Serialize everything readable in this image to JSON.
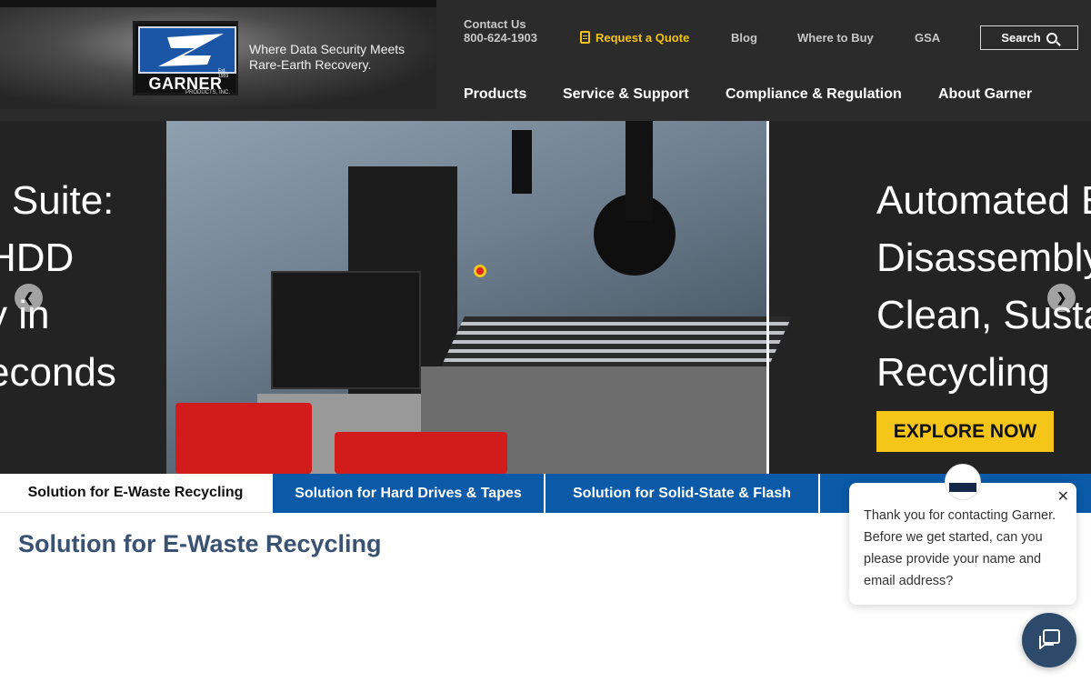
{
  "brand": {
    "logo_name": "GARNER",
    "logo_sub": "PRODUCTS, INC.",
    "logo_est": "Est. 1959",
    "tagline_line1": "Where Data Security Meets",
    "tagline_line2": "Rare-Earth Recovery."
  },
  "utility": {
    "contact_label": "Contact Us",
    "contact_phone": "800-624-1903",
    "quote": "Request a Quote",
    "blog": "Blog",
    "where_to_buy": "Where to Buy",
    "gsa": "GSA",
    "search": "Search"
  },
  "nav": {
    "products": "Products",
    "service": "Service & Support",
    "compliance": "Compliance & Regulation",
    "about": "About Garner"
  },
  "hero": {
    "left_lines": [
      "r Suite:",
      "HDD",
      "y in",
      "econds"
    ],
    "right_lines": [
      "Automated E",
      "Disassembly",
      "Clean, Susta",
      "Recycling"
    ],
    "cta": "EXPLORE NOW",
    "prev_icon": "chevron-left-icon",
    "next_icon": "chevron-right-icon"
  },
  "tabs": [
    {
      "label": "Solution for E-Waste Recycling",
      "active": true
    },
    {
      "label": "Solution for Hard Drives & Tapes",
      "active": false
    },
    {
      "label": "Solution for Solid-State & Flash",
      "active": false
    },
    {
      "label": "",
      "active": false
    }
  ],
  "section": {
    "title": "Solution for E-Waste Recycling"
  },
  "chat": {
    "message": "Thank you for contacting Garner. Before we get started, can you please provide your name and email address?",
    "close_icon": "close-icon",
    "launcher_icon": "chat-icon"
  },
  "colors": {
    "header_bg": "#2b2b2b",
    "accent_yellow": "#f5c518",
    "tab_blue": "#0a5aa8",
    "title_blue": "#3a5272",
    "chat_launcher": "#2e4a6a"
  }
}
